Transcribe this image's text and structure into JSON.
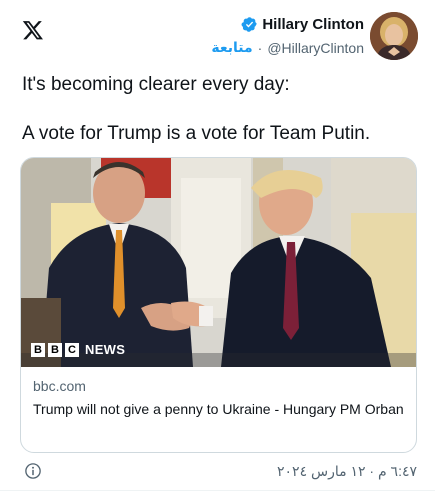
{
  "header": {
    "display_name": "Hillary Clinton",
    "handle": "@HillaryClinton",
    "follow_label": "متابعة",
    "separator": "·",
    "icons": {
      "logo": "x-logo-icon",
      "verified": "verified-badge-icon"
    }
  },
  "tweet": {
    "line1": "It's becoming clearer every day:",
    "line2": "A vote for Trump is a vote for Team Putin."
  },
  "link_card": {
    "badge_letters": [
      "B",
      "B",
      "C"
    ],
    "badge_word": "NEWS",
    "domain": "bbc.com",
    "headline": "Trump will not give a penny to Ukraine - Hungary PM Orban"
  },
  "footer": {
    "timestamp": "٦:٤٧ م · ١٢ مارس ٢٠٢٤",
    "icons": {
      "info": "info-icon"
    }
  },
  "colors": {
    "accent": "#1d9bf0",
    "text": "#0f1419",
    "muted": "#536471",
    "border": "#cfd9de"
  }
}
